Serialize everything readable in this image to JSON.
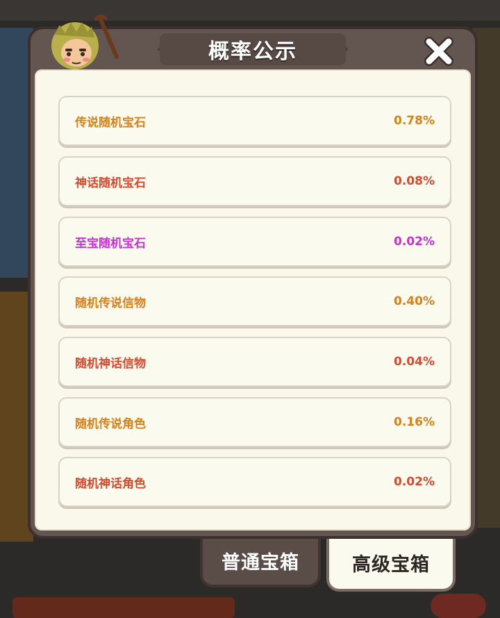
{
  "dialog": {
    "title": "概率公示",
    "close_icon": "close-x-icon"
  },
  "rows": [
    {
      "name": "传说随机宝石",
      "rate": "0.78%",
      "color": "#d98118"
    },
    {
      "name": "神话随机宝石",
      "rate": "0.08%",
      "color": "#d9492e"
    },
    {
      "name": "至宝随机宝石",
      "rate": "0.02%",
      "color": "#cc2fd6"
    },
    {
      "name": "随机传说信物",
      "rate": "0.40%",
      "color": "#d98118"
    },
    {
      "name": "随机神话信物",
      "rate": "0.04%",
      "color": "#d9492e"
    },
    {
      "name": "随机传说角色",
      "rate": "0.16%",
      "color": "#d98118"
    },
    {
      "name": "随机神话角色",
      "rate": "0.02%",
      "color": "#d9492e"
    }
  ],
  "tabs": [
    {
      "label": "普通宝箱",
      "selected": false
    },
    {
      "label": "高级宝箱",
      "selected": true
    }
  ],
  "colors": {
    "dialog_bg": "#63554f",
    "panel_bg": "#f9f8ea",
    "legendary": "#d98118",
    "mythic": "#d9492e",
    "supreme": "#cc2fd6"
  }
}
